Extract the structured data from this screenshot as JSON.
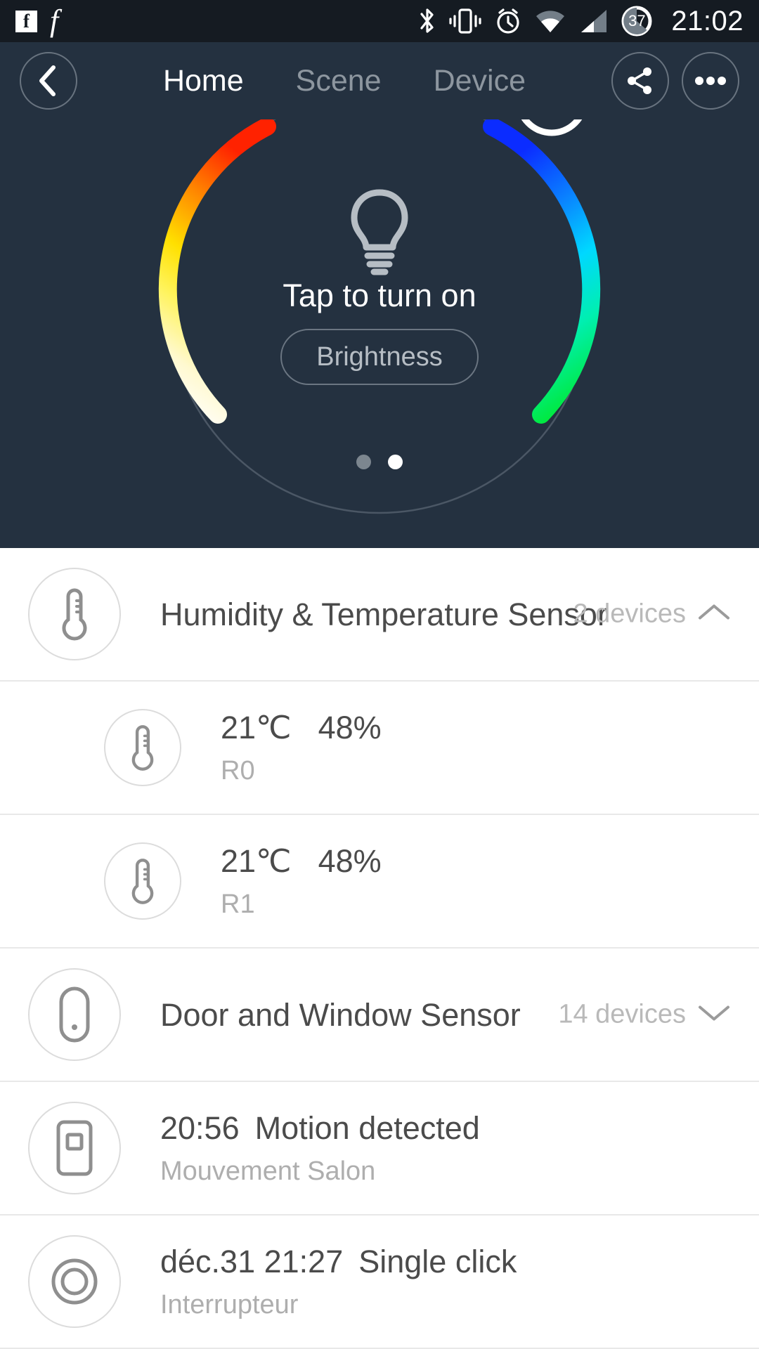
{
  "statusbar": {
    "time": "21:02",
    "battery_percent": "37",
    "icons": [
      "facebook-icon",
      "f-app-icon",
      "bluetooth-icon",
      "vibrate-icon",
      "alarm-icon",
      "wifi-icon",
      "signal-icon",
      "battery-icon"
    ]
  },
  "navbar": {
    "back_label": "back-chevron-icon",
    "tabs": [
      {
        "label": "Home",
        "active": true
      },
      {
        "label": "Scene",
        "active": false
      },
      {
        "label": "Device",
        "active": false
      }
    ],
    "share_label": "share-icon",
    "more_label": "more-icon"
  },
  "hero": {
    "bulb_icon": "lightbulb-icon",
    "tap_label": "Tap to turn on",
    "brightness_label": "Brightness",
    "pager": {
      "count": 2,
      "active_index": 1
    },
    "colors": {
      "panel_bg": "#243140",
      "arc_left_stops": [
        "#ff2d00",
        "#ff8a00",
        "#ffe500",
        "#fff7c2",
        "#ffffff"
      ],
      "arc_right_stops": [
        "#0b3bff",
        "#0a8cff",
        "#00e5ff",
        "#00f0a0",
        "#00e020"
      ]
    }
  },
  "list": {
    "groups": [
      {
        "icon": "thermometer-icon",
        "title": "Humidity & Temperature Sensor",
        "count": "2 devices",
        "chevron": "chevron-up-icon",
        "expanded": true
      },
      {
        "icon": "door-window-sensor-icon",
        "title": "Door and Window Sensor",
        "count": "14 devices",
        "chevron": "chevron-down-icon",
        "expanded": false
      }
    ],
    "sensor_rows": [
      {
        "icon": "thermometer-icon",
        "temperature": "21℃",
        "humidity": "48%",
        "name": "R0"
      },
      {
        "icon": "thermometer-icon",
        "temperature": "21℃",
        "humidity": "48%",
        "name": "R1"
      }
    ],
    "event_rows": [
      {
        "icon": "motion-sensor-icon",
        "time": "20:56",
        "event": "Motion detected",
        "name": "Mouvement Salon"
      },
      {
        "icon": "button-switch-icon",
        "time": "déc.31 21:27",
        "event": "Single click",
        "name": "Interrupteur"
      }
    ]
  }
}
